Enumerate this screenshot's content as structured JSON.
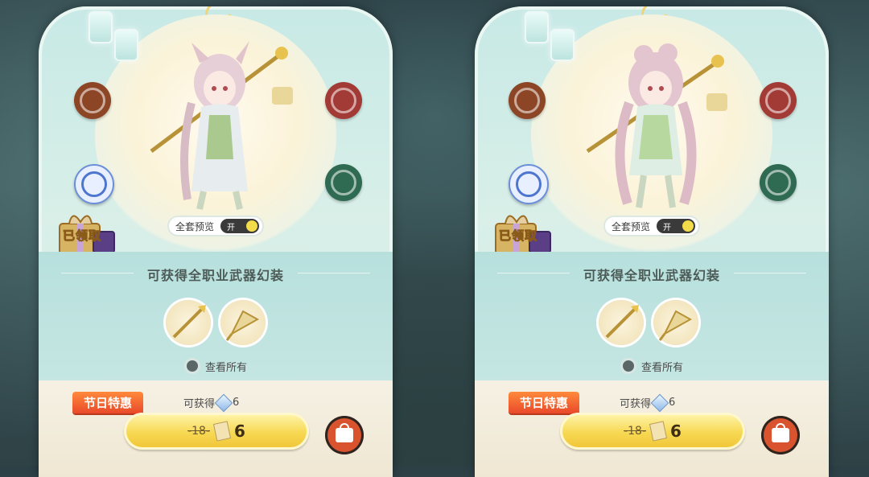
{
  "panels": [
    {
      "toggle": {
        "label": "全套预览",
        "state": "开"
      },
      "gift": {
        "label": "已领取"
      },
      "weapons": {
        "title": "可获得全职业武器幻装",
        "view_all": "查看所有"
      },
      "purchase": {
        "badge": "节日特惠",
        "obtain_label": "可获得",
        "obtain_count": "6",
        "old_price": "18",
        "new_price": "6"
      }
    },
    {
      "toggle": {
        "label": "全套预览",
        "state": "开"
      },
      "gift": {
        "label": "已领取"
      },
      "weapons": {
        "title": "可获得全职业武器幻装",
        "view_all": "查看所有"
      },
      "purchase": {
        "badge": "节日特惠",
        "obtain_label": "可获得",
        "obtain_count": "6",
        "old_price": "18",
        "new_price": "6"
      }
    }
  ],
  "colors": {
    "panel_bg": "#c7e9e6",
    "badge": "#e9492a",
    "button_gold": "#f7d852",
    "shop_button": "#d9532e"
  },
  "icons": [
    "clan-emblem-brown",
    "clan-emblem-red",
    "clan-emblem-blue",
    "clan-emblem-green",
    "gift-box-icon",
    "gem-icon",
    "ticket-icon",
    "shop-bag-icon"
  ]
}
